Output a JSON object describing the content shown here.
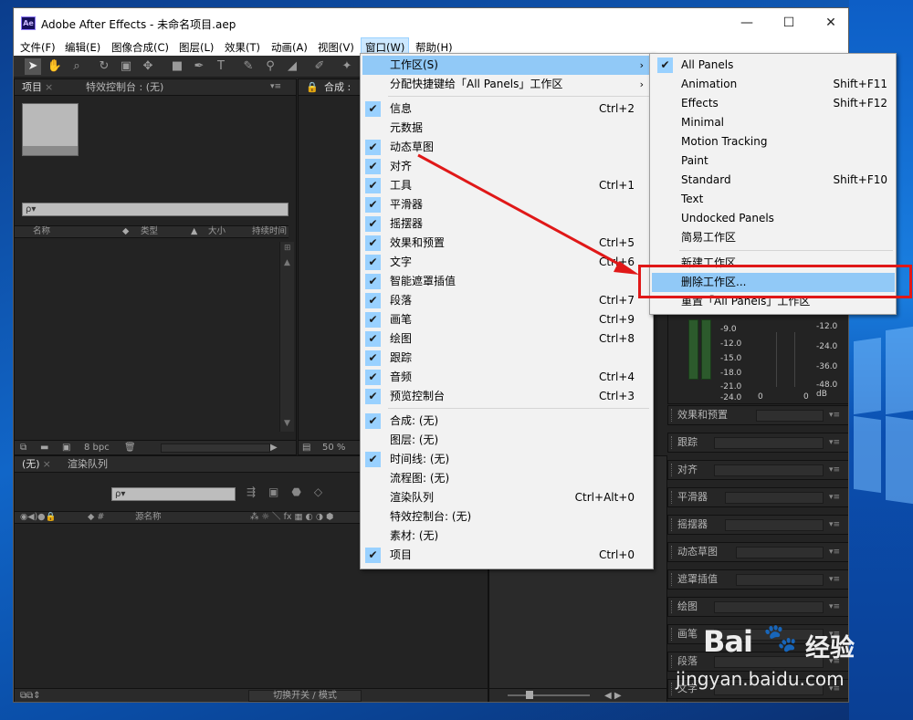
{
  "window": {
    "title": "Adobe After Effects - 未命名项目.aep",
    "logo": "Ae",
    "controls": {
      "minimize": "—",
      "maximize": "☐",
      "close": "✕"
    }
  },
  "menubar": {
    "items": [
      "文件(F)",
      "编辑(E)",
      "图像合成(C)",
      "图层(L)",
      "效果(T)",
      "动画(A)",
      "视图(V)",
      "窗口(W)",
      "帮助(H)"
    ],
    "active": "窗口(W)"
  },
  "project_panel": {
    "tabs": [
      "项目",
      "特效控制台 : (无)"
    ],
    "columns": [
      "名称",
      "类型",
      "大小",
      "持续时间"
    ],
    "bpc": "8 bpc",
    "search_placeholder": "ρ▾"
  },
  "comp_panel": {
    "tab": "合成 :",
    "zoom": "50 %"
  },
  "timeline_panel": {
    "tabs": [
      "(无)",
      "渲染队列"
    ],
    "col_source": "源名称",
    "footer_toggle": "切换开关 / 模式"
  },
  "window_menu": {
    "items": [
      {
        "label": "工作区(S)",
        "shortcut": "",
        "checked": false,
        "submenu": true,
        "highlight": true
      },
      {
        "label": "分配快捷键给「All Panels」工作区",
        "shortcut": "",
        "checked": false,
        "submenu": true
      },
      {
        "sep": true
      },
      {
        "label": "信息",
        "shortcut": "Ctrl+2",
        "checked": true
      },
      {
        "label": "元数据",
        "shortcut": "",
        "checked": false
      },
      {
        "label": "动态草图",
        "shortcut": "",
        "checked": true
      },
      {
        "label": "对齐",
        "shortcut": "",
        "checked": true
      },
      {
        "label": "工具",
        "shortcut": "Ctrl+1",
        "checked": true
      },
      {
        "label": "平滑器",
        "shortcut": "",
        "checked": true
      },
      {
        "label": "摇摆器",
        "shortcut": "",
        "checked": true
      },
      {
        "label": "效果和预置",
        "shortcut": "Ctrl+5",
        "checked": true
      },
      {
        "label": "文字",
        "shortcut": "Ctrl+6",
        "checked": true
      },
      {
        "label": "智能遮罩插值",
        "shortcut": "",
        "checked": true
      },
      {
        "label": "段落",
        "shortcut": "Ctrl+7",
        "checked": true
      },
      {
        "label": "画笔",
        "shortcut": "Ctrl+9",
        "checked": true
      },
      {
        "label": "绘图",
        "shortcut": "Ctrl+8",
        "checked": true
      },
      {
        "label": "跟踪",
        "shortcut": "",
        "checked": true
      },
      {
        "label": "音频",
        "shortcut": "Ctrl+4",
        "checked": true
      },
      {
        "label": "预览控制台",
        "shortcut": "Ctrl+3",
        "checked": true
      },
      {
        "sep": true
      },
      {
        "label": "合成: (无)",
        "shortcut": "",
        "checked": true
      },
      {
        "label": "图层: (无)",
        "shortcut": "",
        "checked": false
      },
      {
        "label": "时间线: (无)",
        "shortcut": "",
        "checked": true
      },
      {
        "label": "流程图: (无)",
        "shortcut": "",
        "checked": false
      },
      {
        "label": "渲染队列",
        "shortcut": "Ctrl+Alt+0",
        "checked": false
      },
      {
        "label": "特效控制台: (无)",
        "shortcut": "",
        "checked": false
      },
      {
        "label": "素材: (无)",
        "shortcut": "",
        "checked": false
      },
      {
        "label": "项目",
        "shortcut": "Ctrl+0",
        "checked": true
      }
    ]
  },
  "workspace_submenu": {
    "items": [
      {
        "label": "All Panels",
        "shortcut": "",
        "checked": true
      },
      {
        "label": "Animation",
        "shortcut": "Shift+F11"
      },
      {
        "label": "Effects",
        "shortcut": "Shift+F12"
      },
      {
        "label": "Minimal",
        "shortcut": ""
      },
      {
        "label": "Motion Tracking",
        "shortcut": ""
      },
      {
        "label": "Paint",
        "shortcut": ""
      },
      {
        "label": "Standard",
        "shortcut": "Shift+F10"
      },
      {
        "label": "Text",
        "shortcut": ""
      },
      {
        "label": "Undocked Panels",
        "shortcut": ""
      },
      {
        "label": "简易工作区",
        "shortcut": ""
      },
      {
        "sep": true
      },
      {
        "label": "新建工作区...",
        "shortcut": ""
      },
      {
        "label": "删除工作区...",
        "shortcut": "",
        "highlight": true
      },
      {
        "label": "重置「All Panels」工作区",
        "shortcut": ""
      }
    ]
  },
  "audio_panel": {
    "left_labels": [
      "-9.0",
      "-12.0",
      "-15.0",
      "-18.0",
      "-21.0",
      "-24.0"
    ],
    "right_labels": [
      "-12.0",
      "-24.0",
      "-36.0",
      "-48.0 dB"
    ],
    "zeros": [
      "0",
      "0"
    ]
  },
  "right_panels": [
    "效果和预置",
    "跟踪",
    "对齐",
    "平滑器",
    "摇摆器",
    "动态草图",
    "遮罩插值",
    "绘图",
    "画笔",
    "段落",
    "文字"
  ],
  "watermark": {
    "logo": "Bai",
    "paw": "🐾",
    "cn": "经验",
    "url": "jingyan.baidu.com"
  },
  "colors": {
    "highlight": "#91c9f7",
    "check_bg": "#99d1ff",
    "annotation": "#e01818"
  }
}
